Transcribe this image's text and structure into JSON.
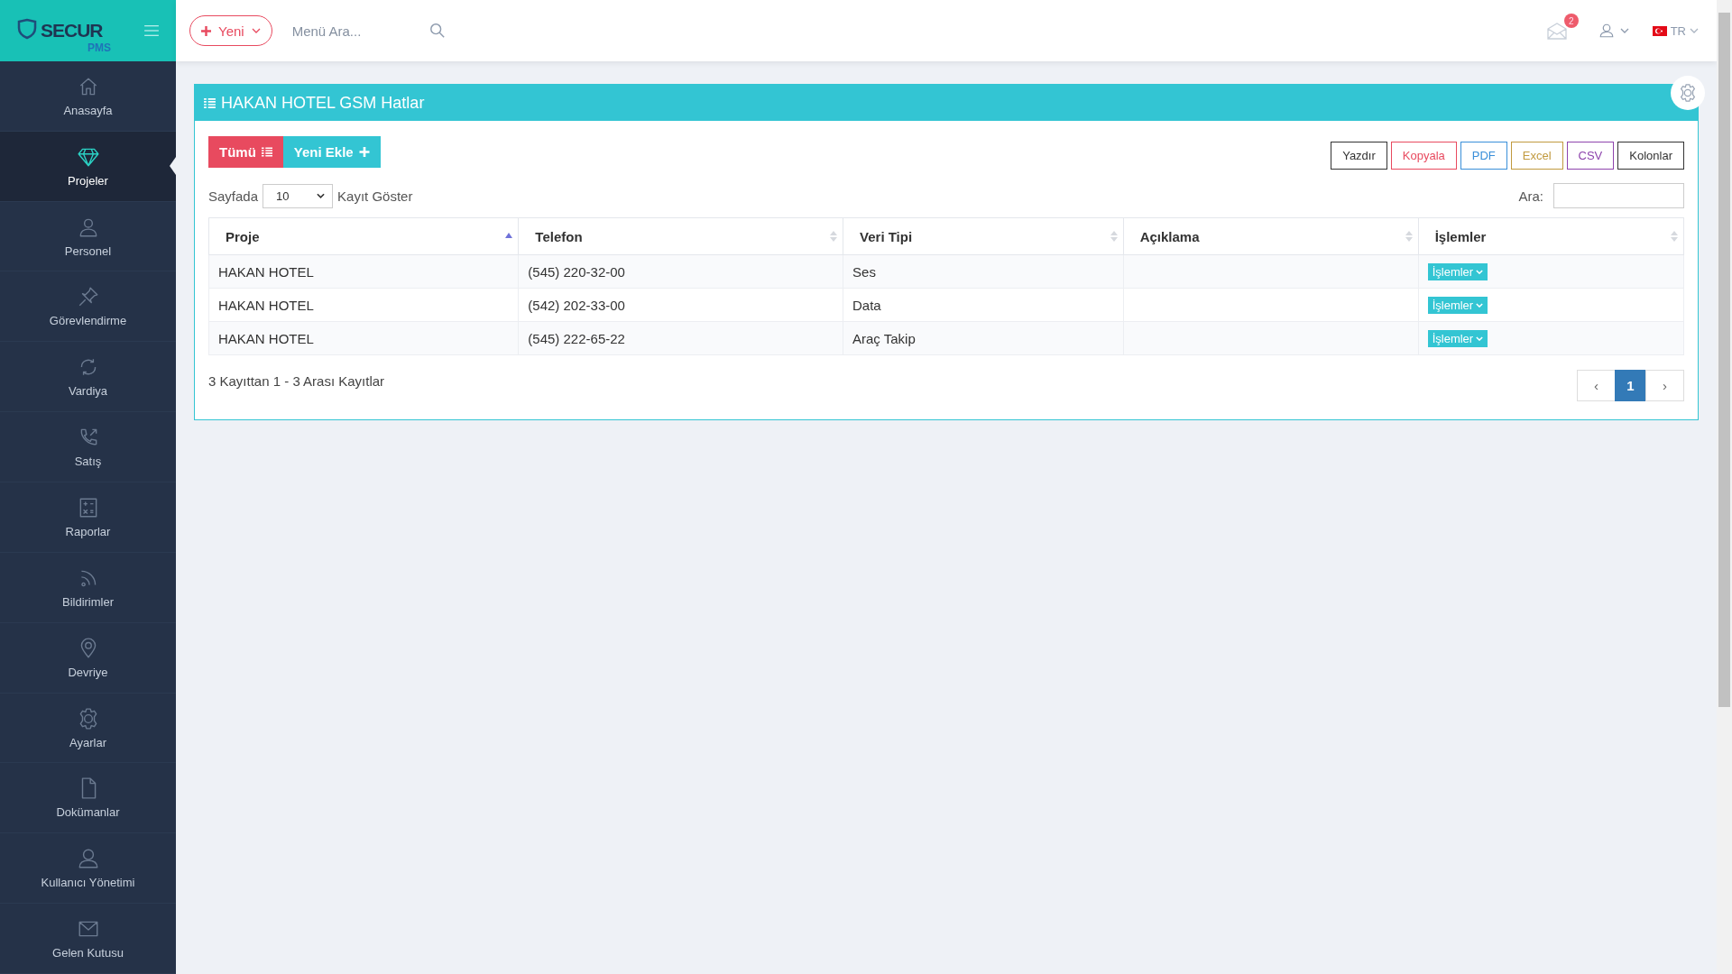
{
  "logo": {
    "title": "SECUR",
    "subtitle": "PMS"
  },
  "topbar": {
    "new_button": "Yeni",
    "search": {
      "placeholder": "Menü Ara..."
    },
    "notification_count": "2",
    "language": "TR"
  },
  "sidebar": {
    "items": [
      {
        "label": "Anasayfa",
        "selected": false
      },
      {
        "label": "Projeler",
        "selected": true
      },
      {
        "label": "Personel",
        "selected": false
      },
      {
        "label": "Görevlendirme",
        "selected": false
      },
      {
        "label": "Vardiya",
        "selected": false
      },
      {
        "label": "Satış",
        "selected": false
      },
      {
        "label": "Raporlar",
        "selected": false
      },
      {
        "label": "Bildirimler",
        "selected": false
      },
      {
        "label": "Devriye",
        "selected": false
      },
      {
        "label": "Ayarlar",
        "selected": false
      },
      {
        "label": "Dokümanlar",
        "selected": false
      },
      {
        "label": "Kullanıcı Yönetimi",
        "selected": false
      },
      {
        "label": "Gelen Kutusu",
        "selected": false
      }
    ]
  },
  "panel": {
    "title": "HAKAN HOTEL GSM Hatlar",
    "actions": [
      {
        "label": "Tümü",
        "kind": "list"
      },
      {
        "label": "Yeni Ekle",
        "kind": "add"
      }
    ],
    "export_buttons": [
      {
        "label": "Yazdır",
        "color": "#333333"
      },
      {
        "label": "Kopyala",
        "color": "#e84a5f"
      },
      {
        "label": "PDF",
        "color": "#3a8fd9"
      },
      {
        "label": "Excel",
        "color": "#c19a3f"
      },
      {
        "label": "CSV",
        "color": "#8e44ad"
      },
      {
        "label": "Kolonlar",
        "color": "#333333"
      }
    ],
    "page_size": {
      "before": "Sayfada",
      "value": "10",
      "after": "Kayıt Göster"
    },
    "search_label": "Ara:",
    "table": {
      "columns": [
        {
          "label": "Proje",
          "sorted": true
        },
        {
          "label": "Telefon",
          "sorted": false
        },
        {
          "label": "Veri Tipi",
          "sorted": false
        },
        {
          "label": "Açıklama",
          "sorted": false
        },
        {
          "label": "İşlemler",
          "sorted": false
        }
      ],
      "rows": [
        {
          "proje": "HAKAN HOTEL",
          "telefon": "(545) 220-32-00",
          "veri_tipi": "Ses",
          "action": "İşlemler"
        },
        {
          "proje": "HAKAN HOTEL",
          "telefon": "(542) 202-33-00",
          "veri_tipi": "Data",
          "action": "İşlemler"
        },
        {
          "proje": "HAKAN HOTEL",
          "telefon": "(545) 222-65-22",
          "veri_tipi": "Araç Takip",
          "action": "İşlemler"
        }
      ]
    },
    "info": "3 Kayıttan 1 - 3 Arası Kayıtlar",
    "pagination": {
      "prev": "‹",
      "pages": [
        {
          "label": "1",
          "selected": true
        }
      ],
      "next": "›"
    }
  }
}
